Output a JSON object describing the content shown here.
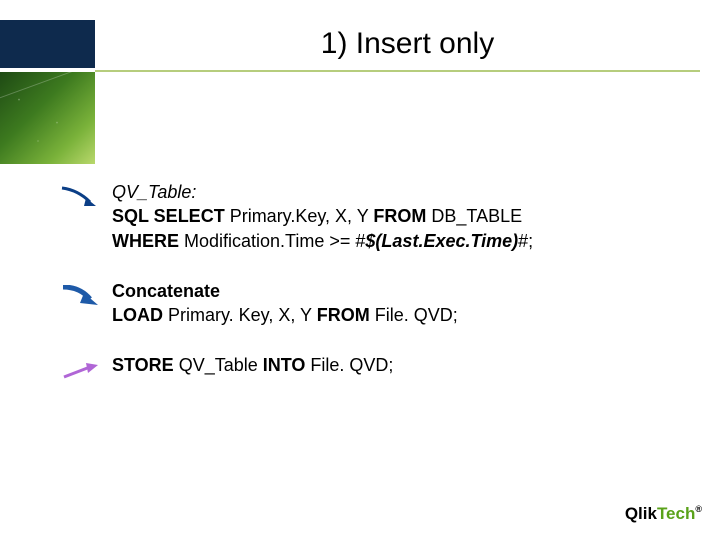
{
  "title": "1) Insert only",
  "code": {
    "block1": {
      "tableLabel": "QV_Table:",
      "kw_sqlselect": "SQL SELECT",
      "selectCols": " Primary.Key, X, Y ",
      "kw_from": "FROM",
      "tableName": " DB_TABLE",
      "kw_where": "WHERE",
      "whereField": " Modification.Time >= #",
      "whereExpr": "$(Last.Exec.Time)",
      "whereTail": "#;"
    },
    "block2": {
      "kw_concat": "Concatenate",
      "kw_load": "LOAD",
      "loadCols": " Primary. Key, X, Y ",
      "kw_from": "FROM",
      "fromFile": " File. QVD;"
    },
    "block3": {
      "kw_store": "STORE",
      "storeTable": " QV_Table ",
      "kw_into": "INTO",
      "intoFile": " File. QVD;"
    }
  },
  "logo": {
    "part1": "Qlik",
    "part2": "Tech",
    "reg": "®"
  },
  "arrows": {
    "a1": {
      "stroke": "#0b3e86",
      "fill": "#0b3e86"
    },
    "a2": {
      "stroke": "#1e5aa8",
      "fill": "#1e5aa8"
    },
    "a3": {
      "stroke": "#b066d6",
      "fill": "#b066d6"
    }
  }
}
